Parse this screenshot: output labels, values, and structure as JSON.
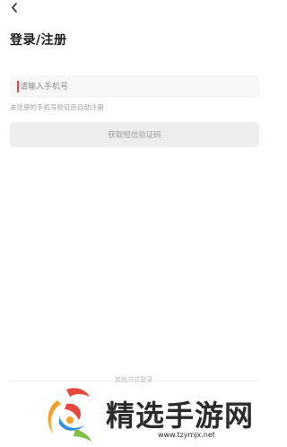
{
  "header": {
    "back_icon": "chevron-left-icon",
    "title": "登录/注册"
  },
  "login": {
    "phone_placeholder": "请输入手机号",
    "phone_value": "",
    "hint": "未注册的手机号验证后自动注册",
    "sms_button_label": "获取短信验证码"
  },
  "footer": {
    "other_methods_label": "其他方式登录"
  },
  "watermark": {
    "brand": "精选手游网",
    "url": "www.tzymjx.net"
  },
  "colors": {
    "caret": "#e0445a",
    "button_bg": "#ededed"
  }
}
